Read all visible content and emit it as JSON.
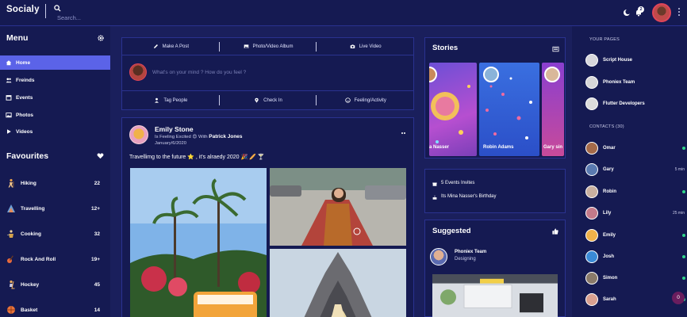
{
  "app": {
    "title": "Socialy",
    "search_placeholder": "Search...",
    "notification_count": "2",
    "icons": [
      "search-icon",
      "moon-icon",
      "bell-icon",
      "kebab-icon"
    ]
  },
  "left": {
    "menu_title": "Menu",
    "menu_items": [
      {
        "label": "Home",
        "icon": "home-icon",
        "active": true
      },
      {
        "label": "Freinds",
        "icon": "friends-icon"
      },
      {
        "label": "Events",
        "icon": "calendar-icon"
      },
      {
        "label": "Photos",
        "icon": "photo-icon"
      },
      {
        "label": "Videos",
        "icon": "play-icon"
      }
    ],
    "favourites_title": "Favourites",
    "favourites": [
      {
        "label": "Hiking",
        "count": "22",
        "color": "#e9a04a"
      },
      {
        "label": "Travelling",
        "count": "12+",
        "color": "#e38b5a"
      },
      {
        "label": "Cooking",
        "count": "32",
        "color": "#d4a24c"
      },
      {
        "label": "Rock And Roll",
        "count": "19+",
        "color": "#e86a3c"
      },
      {
        "label": "Hockey",
        "count": "45",
        "color": "#f0b060"
      },
      {
        "label": "Basket",
        "count": "14",
        "color": "#e9733a"
      }
    ]
  },
  "composer": {
    "tabs": [
      "Make A Post",
      "Photo/Video Album",
      "Live Video"
    ],
    "placeholder": "What's on your mind ? How do you feel ?",
    "actions": [
      "Tag People",
      "Check In",
      "Feeling/Activity"
    ]
  },
  "post": {
    "author": "Emily Stone",
    "feeling_prefix": "Is Feeling Excited 😍 With",
    "with": "Patrick Jones",
    "date": "January/6/2020",
    "text": "Travellimg to the future ⭐ , it's alraedy 2020 🎉 🥖 🍸"
  },
  "stories": {
    "title": "Stories",
    "items": [
      {
        "name": "a Nasser"
      },
      {
        "name": "Robin Adams"
      },
      {
        "name": "Gary sin"
      }
    ]
  },
  "events": {
    "invites": "5 Events Invites",
    "birthday": "Its Mina Nasser's Birthday"
  },
  "suggested": {
    "title": "Suggested",
    "name": "Phoniex Team",
    "category": "Designing"
  },
  "right": {
    "pages_title": "YOUR PAGES",
    "pages": [
      "Script House",
      "Phoniex Team",
      "Flutter Developers"
    ],
    "contacts_title": "CONTACTS (30)",
    "contacts": [
      {
        "name": "Omar",
        "meta": "",
        "online": true
      },
      {
        "name": "Gary",
        "meta": "5 min",
        "online": false
      },
      {
        "name": "Robin",
        "meta": "",
        "online": true
      },
      {
        "name": "Lily",
        "meta": "25 min",
        "online": false
      },
      {
        "name": "Emily",
        "meta": "",
        "online": true
      },
      {
        "name": "Josh",
        "meta": "",
        "online": true
      },
      {
        "name": "Simon",
        "meta": "",
        "online": true
      },
      {
        "name": "Sarah",
        "meta": "",
        "online": true
      }
    ],
    "chat_count": "0"
  }
}
